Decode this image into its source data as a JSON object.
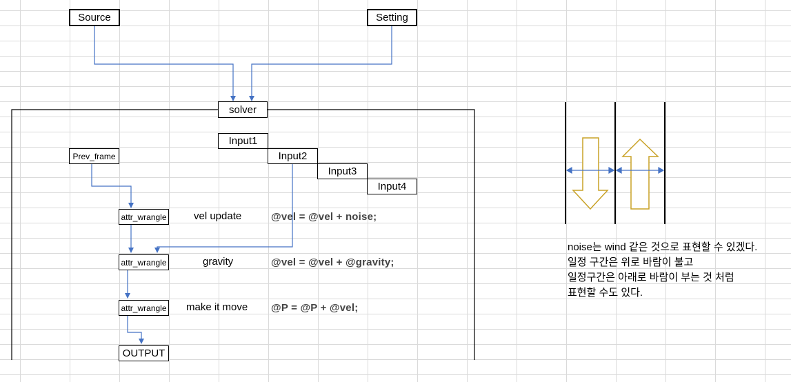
{
  "nodes": {
    "source": "Source",
    "setting": "Setting",
    "solver": "solver",
    "input1": "Input1",
    "input2": "Input2",
    "input3": "Input3",
    "input4": "Input4",
    "prev_frame": "Prev_frame",
    "wrangle1": "attr_wrangle",
    "wrangle2": "attr_wrangle",
    "wrangle3": "attr_wrangle",
    "output": "OUTPUT"
  },
  "steps": [
    {
      "label": "vel update",
      "code": "@vel = @vel + noise;"
    },
    {
      "label": "gravity",
      "code": "@vel = @vel + @gravity;"
    },
    {
      "label": "make it move",
      "code": "@P = @P + @vel;"
    }
  ],
  "note": [
    "noise는 wind 같은 것으로 표현할 수 있겠다.",
    "일정 구간은 위로 바람이 불고",
    "일정구간은 아래로 바람이 부는 것 처럼",
    "표현할 수도 있다."
  ],
  "colors": {
    "connector": "#4472c4",
    "wind_arrow": "#c9a227",
    "gridline": "#dadada"
  }
}
